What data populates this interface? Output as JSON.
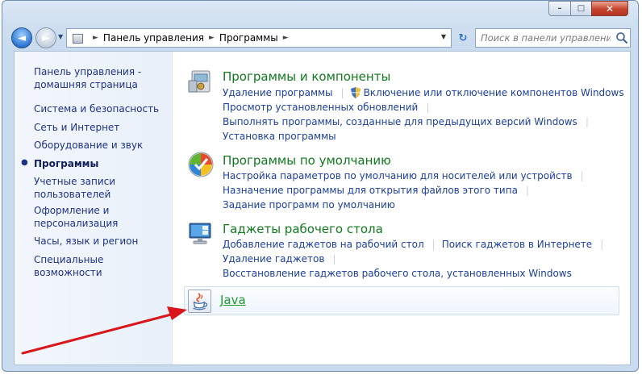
{
  "window": {
    "caption_buttons": {
      "minimize": "–",
      "maximize": "□",
      "close": "✕"
    }
  },
  "nav": {
    "back_glyph": "◄",
    "forward_glyph": "►",
    "dropdown_glyph": "▼",
    "breadcrumb": [
      "Панель управления",
      "Программы"
    ],
    "separator_glyph": "►",
    "refresh_glyph": "↻",
    "search_placeholder": "Поиск в панели управления"
  },
  "sidebar": {
    "items": [
      {
        "label": "Панель управления -",
        "label2": "домашняя страница"
      },
      {
        "label": "Система и безопасность"
      },
      {
        "label": "Сеть и Интернет"
      },
      {
        "label": "Оборудование и звук"
      },
      {
        "label": "Программы",
        "active": true
      },
      {
        "label": "Учетные записи",
        "label2": "пользователей"
      },
      {
        "label": "Оформление и",
        "label2": "персонализация"
      },
      {
        "label": "Часы, язык и регион"
      },
      {
        "label": "Специальные возможности"
      }
    ],
    "bullet": "●"
  },
  "categories": [
    {
      "title": "Программы и компоненты",
      "icon": "programs-features-icon",
      "rows": [
        [
          "Удаление программы",
          "Включение или отключение компонентов Windows"
        ],
        [
          "Просмотр установленных обновлений"
        ],
        [
          "Выполнять программы, созданные для предыдущих версий Windows"
        ],
        [
          "Установка программы"
        ]
      ]
    },
    {
      "title": "Программы по умолчанию",
      "icon": "default-programs-icon",
      "rows": [
        [
          "Настройка параметров по умолчанию для носителей или устройств"
        ],
        [
          "Назначение программы для открытия файлов этого типа"
        ],
        [
          "Задание программ по умолчанию"
        ]
      ]
    },
    {
      "title": "Гаджеты рабочего стола",
      "icon": "desktop-gadgets-icon",
      "rows": [
        [
          "Добавление гаджетов на рабочий стол",
          "Поиск гаджетов в Интернете"
        ],
        [
          "Удаление гаджетов"
        ],
        [
          "Восстановление гаджетов рабочего стола, установленных Windows"
        ]
      ]
    }
  ],
  "java": {
    "label": "Java",
    "icon": "java-icon"
  },
  "colors": {
    "link": "#1c3f9c",
    "category_title": "#117a1f",
    "java_label": "#1e9a2c",
    "arrow": "#d8161c"
  }
}
